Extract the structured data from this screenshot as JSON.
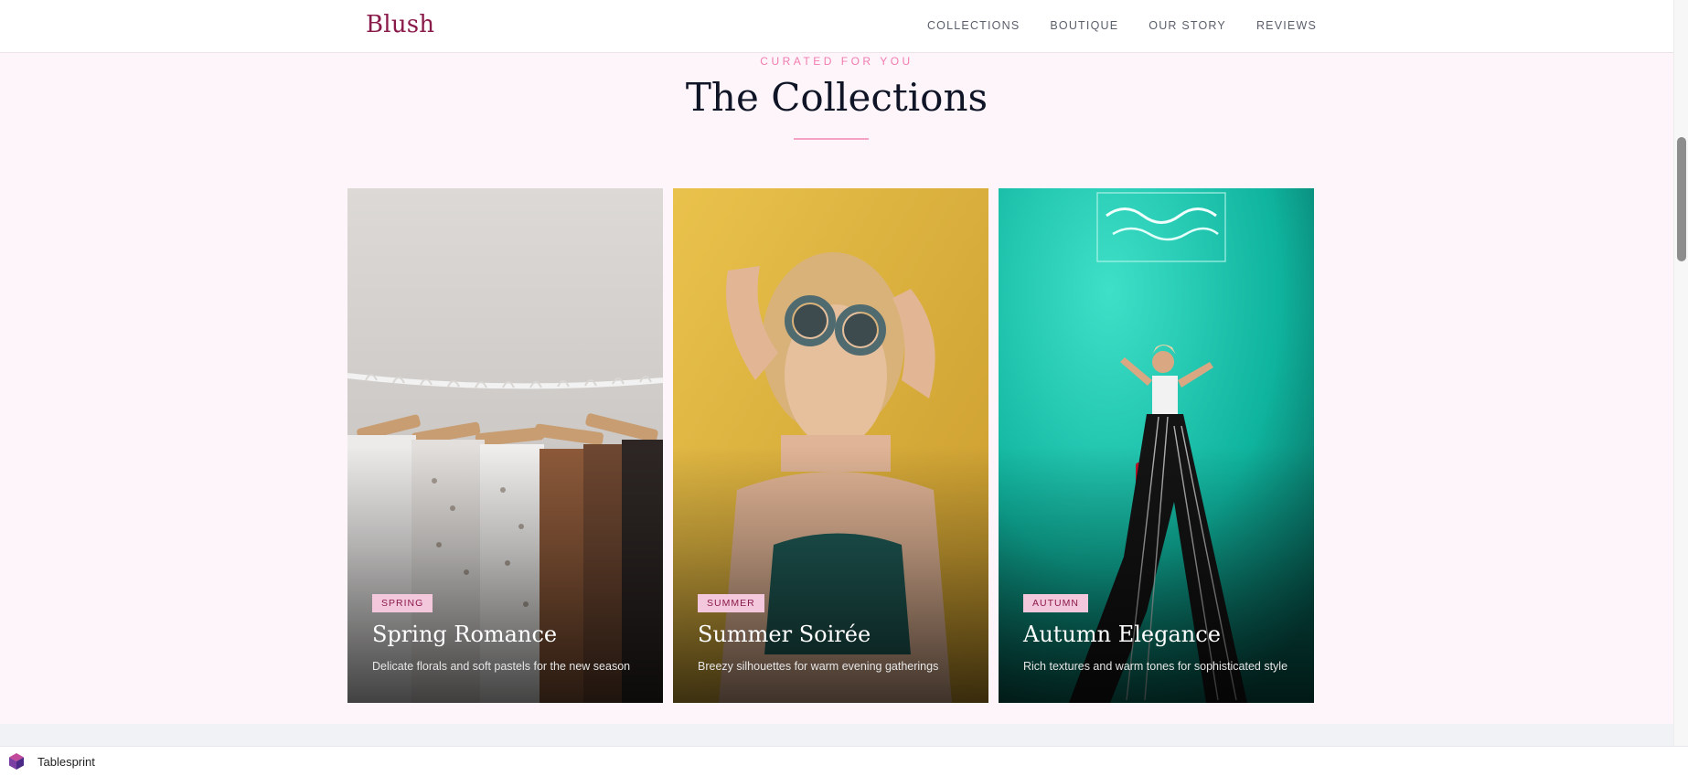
{
  "nav": {
    "brand": "Blush",
    "links": [
      "COLLECTIONS",
      "BOUTIQUE",
      "OUR STORY",
      "REVIEWS"
    ]
  },
  "section": {
    "eyebrow": "CURATED FOR YOU",
    "title": "The Collections"
  },
  "cards": [
    {
      "tag": "SPRING",
      "title": "Spring Romance",
      "description": "Delicate florals and soft pastels for the new season"
    },
    {
      "tag": "SUMMER",
      "title": "Summer Soirée",
      "description": "Breezy silhouettes for warm evening gatherings"
    },
    {
      "tag": "AUTUMN",
      "title": "Autumn Elegance",
      "description": "Rich textures and warm tones for sophisticated style"
    }
  ],
  "statusbar": {
    "app_name": "Tablesprint"
  },
  "colors": {
    "brand": "#8a1a4a",
    "accent": "#f27bb0",
    "tag_bg": "#f4c8dc",
    "page_bg": "#fdf5f9"
  }
}
